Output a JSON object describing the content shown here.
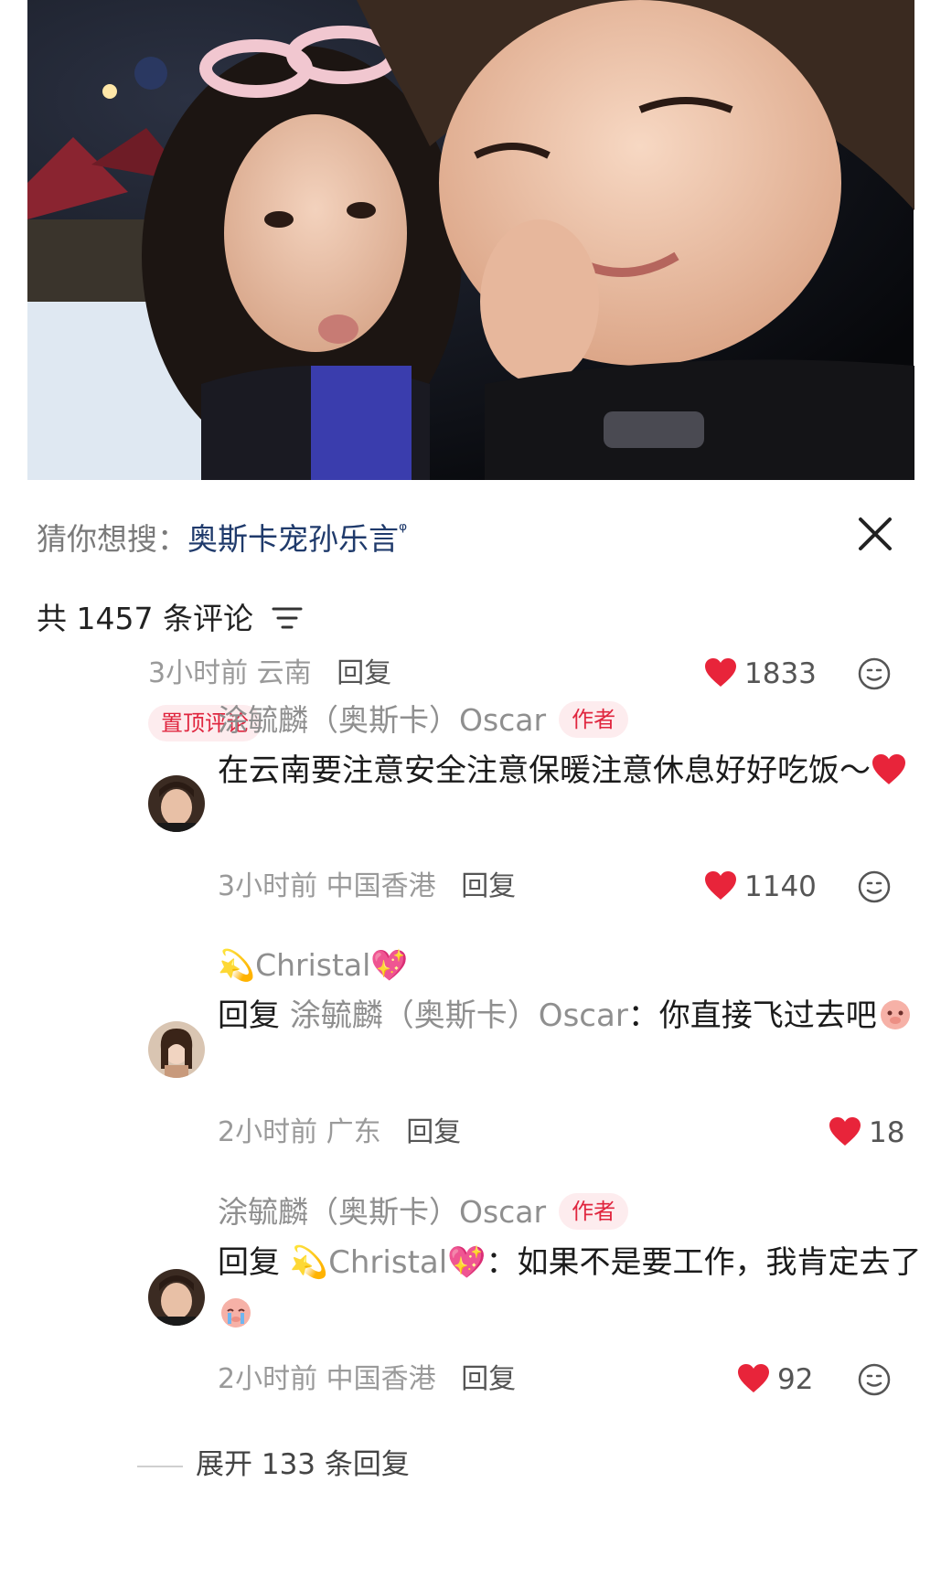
{
  "search_suggestion": {
    "label": "猜你想搜：",
    "term": "奥斯卡宠孙乐言",
    "suffix": "ᵠ"
  },
  "comments_header": {
    "count_text": "共 1457 条评论"
  },
  "top_comment": {
    "meta": {
      "time": "3小时前",
      "location": "云南",
      "reply_label": "回复"
    },
    "likes": "1833",
    "pinned_label": "置顶评论"
  },
  "replies": [
    {
      "name": "涂毓麟（奥斯卡）Oscar",
      "author_tag": "作者",
      "text": "在云南要注意安全注意保暖注意休息好好吃饭～",
      "meta": {
        "time": "3小时前",
        "location": "中国香港",
        "reply_label": "回复"
      },
      "likes": "1140"
    },
    {
      "name": "💫Christal💖",
      "reply_prefix": "回复",
      "reply_target": "涂毓麟（奥斯卡）Oscar",
      "text": "：你直接飞过去吧",
      "meta": {
        "time": "2小时前",
        "location": "广东",
        "reply_label": "回复"
      },
      "likes": "18"
    },
    {
      "name": "涂毓麟（奥斯卡）Oscar",
      "author_tag": "作者",
      "reply_prefix": "回复",
      "reply_target": "💫Christal💖",
      "text": "：如果不是要工作，我肯定去了",
      "meta": {
        "time": "2小时前",
        "location": "中国香港",
        "reply_label": "回复"
      },
      "likes": "92"
    }
  ],
  "expand": {
    "label": "展开 133 条回复"
  },
  "colors": {
    "like": "#e8243a",
    "accent": "#e0263f",
    "link": "#1f3a6b"
  },
  "icons": {
    "close": "close-icon",
    "filter": "filter-icon",
    "heart": "heart-icon",
    "emoji": "smile-icon"
  }
}
